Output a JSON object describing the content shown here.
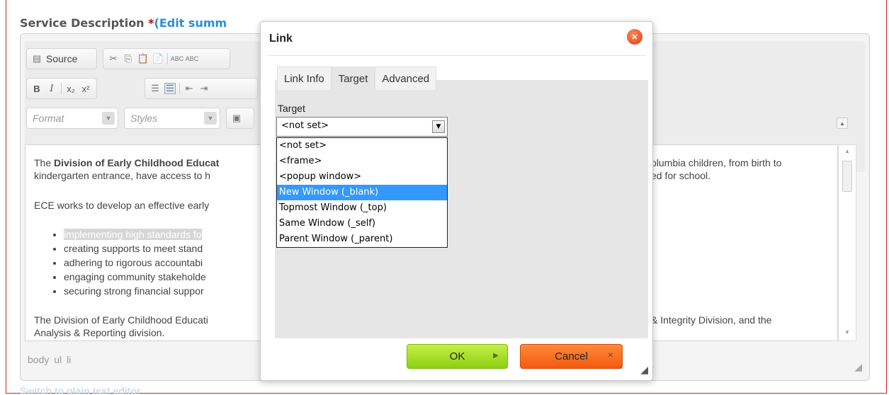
{
  "field": {
    "label": "Service Description ",
    "required_mark": "*",
    "edit_link": "(Edit summ"
  },
  "toolbar": {
    "source_label": "Source",
    "format_placeholder": "Format",
    "styles_placeholder": "Styles"
  },
  "content": {
    "p1_intro": "The ",
    "p1_bold": "Division of Early Childhood Educat",
    "p1_line2": "kindergarten entrance, have access to h",
    "p1_right_line1": "olumbia children, from birth to",
    "p1_right_line2": "ed for school.",
    "p2": "ECE works to develop an effective early",
    "bullets": [
      "implementing high standards fo",
      "creating supports to meet stand",
      "adhering to rigorous accountabi",
      "engaging community stakeholde",
      "securing strong financial suppor"
    ],
    "p3_line1": "The Division of Early Childhood Educati",
    "p3_line2": "Analysis & Reporting division.",
    "p3_right": "& Integrity Division, and the"
  },
  "pathbar": {
    "items": [
      "body",
      "ul",
      "li"
    ]
  },
  "below_editor_link": "Switch to plain text editor",
  "dialog": {
    "title": "Link",
    "tabs": [
      "Link Info",
      "Target",
      "Advanced"
    ],
    "active_tab": "Target",
    "target_label": "Target",
    "target_value": "<not set>",
    "options": [
      "<not set>",
      "<frame>",
      "<popup window>",
      "New Window (_blank)",
      "Topmost Window (_top)",
      "Same Window (_self)",
      "Parent Window (_parent)"
    ],
    "highlighted_option": "New Window (_blank)",
    "ok_label": "OK",
    "cancel_label": "Cancel"
  },
  "colors": {
    "ok_button": "#9bd61c",
    "cancel_button": "#f3641a",
    "selection": "#3399ff",
    "close_button": "#e8431c",
    "frame_border": "#d32020"
  }
}
